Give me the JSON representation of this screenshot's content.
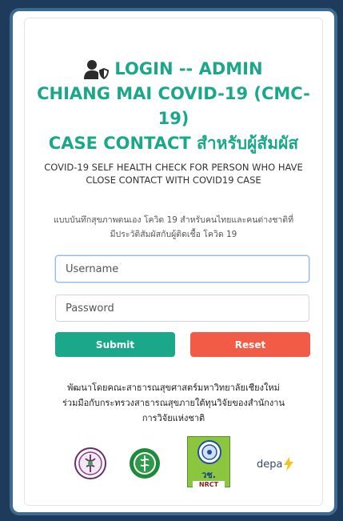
{
  "login": {
    "title_line1": "LOGIN -- ADMIN",
    "title_line2": "CHIANG MAI COVID-19 (CMC-19)",
    "title_line3": "CASE CONTACT สำหรับผู้สัมผัส",
    "icon": "user-shield-icon"
  },
  "subtitle": "COVID-19 SELF HEALTH CHECK FOR PERSON WHO HAVE CLOSE CONTACT WITH COVID19 CASE",
  "thai_subtitle_line1": "แบบบันทึกสุขภาพตนเอง โควิด 19 สำหรับคนไทยและคนต่างชาติที่",
  "thai_subtitle_line2": "มีประวัติสัมผัสกับผู้ติดเชื้อ โควิด 19",
  "form": {
    "username_placeholder": "Username",
    "password_placeholder": "Password",
    "submit_label": "Submit",
    "reset_label": "Reset"
  },
  "credit_line1": "พัฒนาโดยคณะสาธารณสุขศาสตร์มหาวิทยาลัยเชียงใหม่",
  "credit_line2": "ร่วมมือกับกระทรวงสาธารณสุขภายใต้ทุนวิจัยของสำนักงาน",
  "credit_line3": "การวิจัยแห่งชาติ",
  "logos": {
    "nrct_text_thai": "วช.",
    "nrct_text": "NRCT",
    "depa_text": "depa"
  },
  "colors": {
    "brand_green": "#1aa78a",
    "reset_red": "#f25c47",
    "frame_blue": "#3d6a8f"
  }
}
